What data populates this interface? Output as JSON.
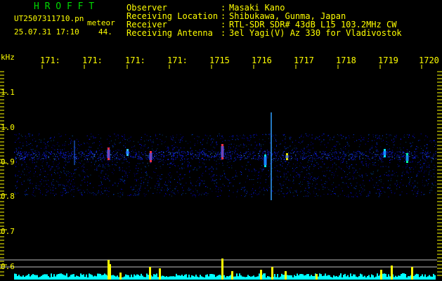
{
  "header": {
    "brand": "H R O F F T",
    "filename": "UT2507311710.pn",
    "meteor_label": "meteor",
    "datetime": "25.07.31 17:10",
    "count": "44.",
    "info_labels": [
      "Observer",
      "Receiving Location",
      "Receiver",
      "Receiving Antenna"
    ],
    "info_colons": [
      ":",
      ":",
      ":",
      ":"
    ],
    "info_values": [
      "Masaki Kano",
      "Shibukawa, Gunma, Japan",
      "RTL-SDR SDR# 43dB L15 103.2MHz CW",
      "3el Yagi(V) Az 330 for Vladivostok"
    ]
  },
  "axes": {
    "unit": "kHz",
    "time_ticks": [
      "171:",
      "171:",
      "171:",
      "171:",
      "1715",
      "1716",
      "1717",
      "1718",
      "1719",
      "1720"
    ],
    "freq_ticks": [
      "1.1",
      "1.0",
      "0.9",
      "0.8",
      "0.7",
      "0.6"
    ]
  },
  "colors": {
    "text": "#ffff00",
    "brand": "#00d800",
    "background": "#000000",
    "spectrum_base": "#00ffff",
    "spectrum_peak": "#ffff00"
  }
}
